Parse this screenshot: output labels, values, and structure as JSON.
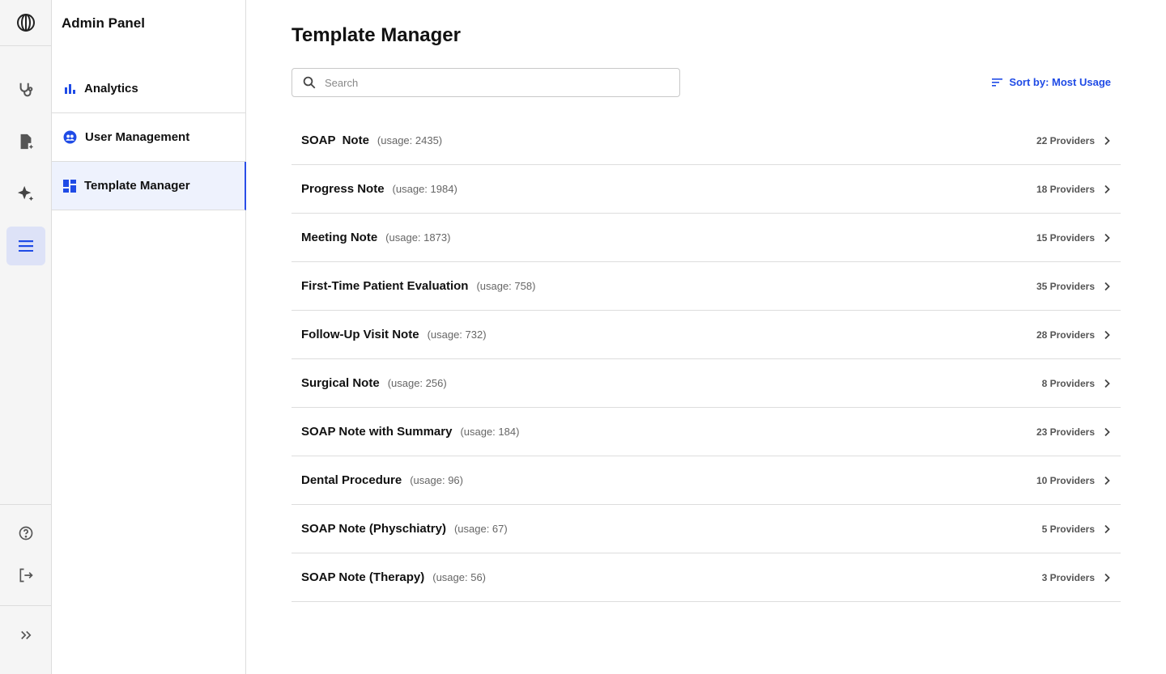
{
  "panel": {
    "title": "Admin Panel",
    "items": [
      {
        "label": "Analytics",
        "icon": "bar-chart-icon"
      },
      {
        "label": "User Management",
        "icon": "users-icon"
      },
      {
        "label": "Template Manager",
        "icon": "dashboard-icon",
        "active": true
      }
    ]
  },
  "main": {
    "title": "Template Manager",
    "search_placeholder": "Search",
    "search_value": "",
    "sort_label": "Sort by: Most Usage"
  },
  "templates": [
    {
      "name": "SOAP  Note",
      "usage": "(usage: 2435)",
      "providers": "22 Providers"
    },
    {
      "name": "Progress Note",
      "usage": "(usage: 1984)",
      "providers": "18 Providers"
    },
    {
      "name": "Meeting Note",
      "usage": "(usage: 1873)",
      "providers": "15 Providers"
    },
    {
      "name": "First-Time Patient Evaluation",
      "usage": "(usage: 758)",
      "providers": "35 Providers"
    },
    {
      "name": "Follow-Up Visit Note",
      "usage": "(usage: 732)",
      "providers": "28 Providers"
    },
    {
      "name": "Surgical Note",
      "usage": "(usage: 256)",
      "providers": "8 Providers"
    },
    {
      "name": "SOAP Note with Summary",
      "usage": "(usage: 184)",
      "providers": "23 Providers"
    },
    {
      "name": "Dental Procedure",
      "usage": "(usage: 96)",
      "providers": "10 Providers"
    },
    {
      "name": "SOAP Note (Physchiatry)",
      "usage": "(usage: 67)",
      "providers": "5 Providers"
    },
    {
      "name": "SOAP Note (Therapy)",
      "usage": "(usage: 56)",
      "providers": "3 Providers"
    }
  ],
  "colors": {
    "accent": "#1f4be6",
    "active_bg": "#eef2fd",
    "rail_bg": "#f5f5f5"
  }
}
